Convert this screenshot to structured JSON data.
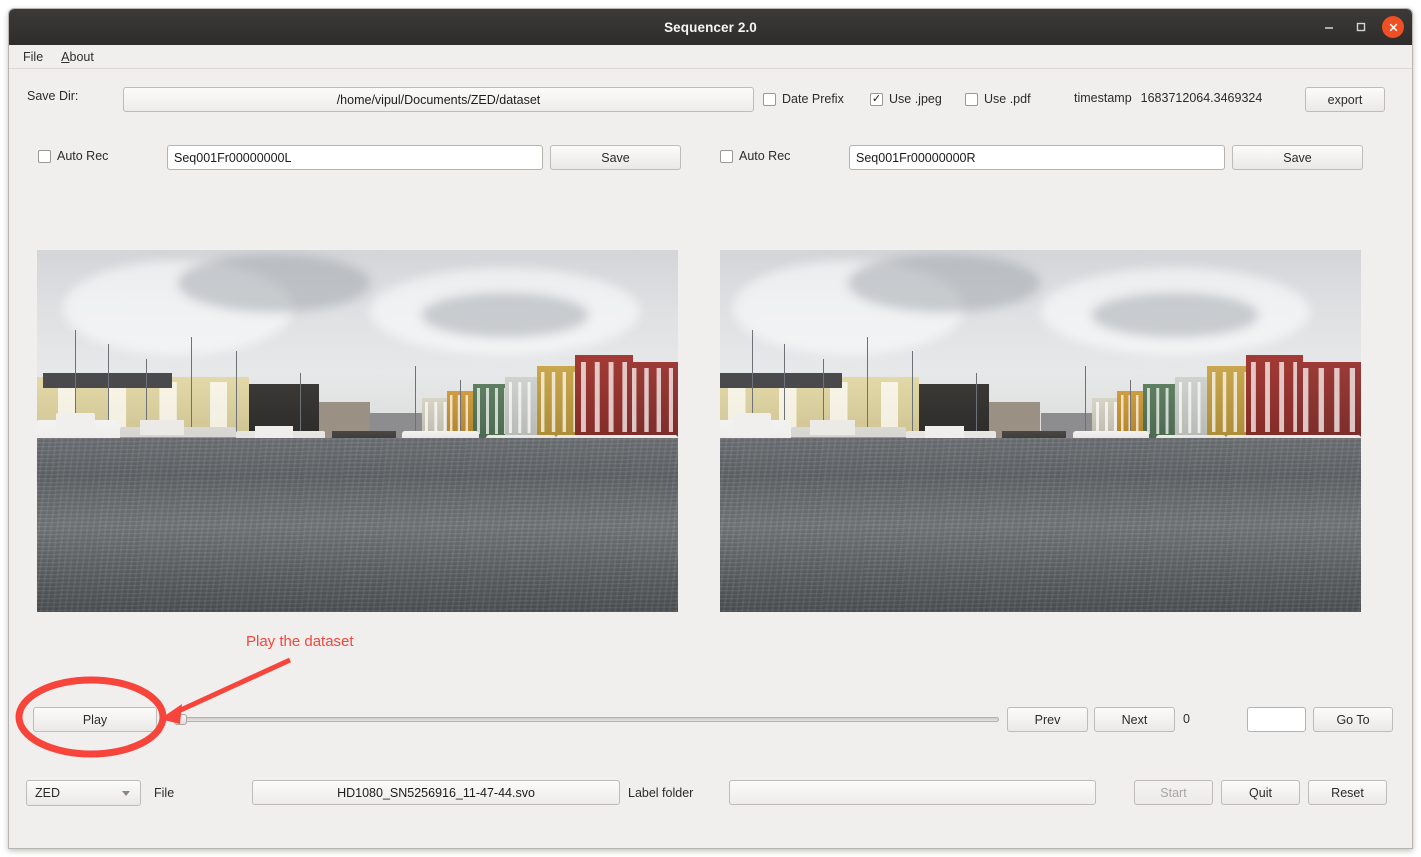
{
  "window": {
    "title": "Sequencer 2.0",
    "minimize_icon": "minimize-icon",
    "maximize_icon": "maximize-icon",
    "close_icon": "close-icon"
  },
  "menubar": {
    "items": [
      {
        "label": "File",
        "mnemonic": ""
      },
      {
        "label": "About",
        "mnemonic": "A"
      }
    ]
  },
  "save_dir_row": {
    "label": "Save Dir:",
    "path_value": "/home/vipul/Documents/ZED/dataset",
    "checkboxes": [
      {
        "label": "Date Prefix",
        "checked": false
      },
      {
        "label": "Use .jpeg",
        "checked": true
      },
      {
        "label": "Use .pdf",
        "checked": false
      }
    ],
    "timestamp_label": "timestamp",
    "timestamp_value": "1683712064.3469324",
    "export_label": "export"
  },
  "capture_rows": {
    "left": {
      "auto_rec_label": "Auto Rec",
      "auto_rec_checked": false,
      "filename_value": "Seq001Fr00000000L",
      "save_label": "Save"
    },
    "right": {
      "auto_rec_label": "Auto Rec",
      "auto_rec_checked": false,
      "filename_value": "Seq001Fr00000000R",
      "save_label": "Save"
    }
  },
  "preview": {
    "left_view_name": "left-camera-preview",
    "right_view_name": "right-camera-preview",
    "scene_description": "Harbor with moored fishing boats and colorful waterfront buildings"
  },
  "playback": {
    "play_label": "Play",
    "slider_value": 0,
    "prev_label": "Prev",
    "next_label": "Next",
    "frame_counter": "0",
    "goto_input_value": "",
    "goto_label": "Go To"
  },
  "footer": {
    "source_selected": "ZED",
    "source_options": [
      "ZED"
    ],
    "file_label": "File",
    "file_value": "HD1080_SN5256916_11-47-44.svo",
    "label_folder_label": "Label folder",
    "label_folder_value": "",
    "start_label": "Start",
    "start_enabled": false,
    "quit_label": "Quit",
    "reset_label": "Reset"
  },
  "annotation": {
    "text": "Play the dataset",
    "color": "#f8453c",
    "target": "play-button"
  },
  "colors": {
    "titlebar": "#33322f",
    "close_button": "#ef4f22",
    "window_bg": "#f0efee",
    "annotation": "#f8453c"
  }
}
